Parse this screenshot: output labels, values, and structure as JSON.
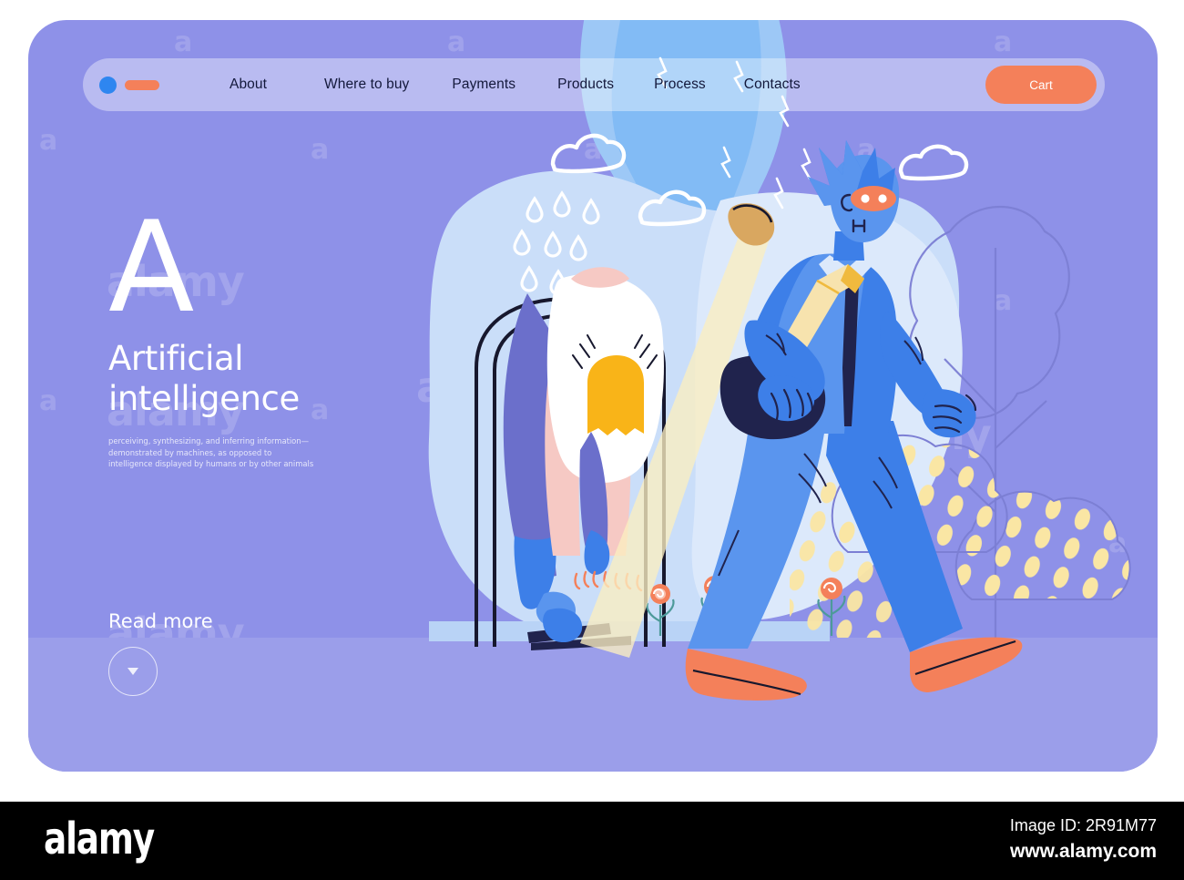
{
  "page": {
    "background_color": "#ffffff",
    "card_color": "#8e91e8"
  },
  "nav": {
    "logo": {
      "dot_color": "#2e86f0",
      "bar_color": "#f4805a"
    },
    "links": [
      {
        "label": "About"
      },
      {
        "label": "Where to buy"
      },
      {
        "label": "Payments"
      },
      {
        "label": "Products"
      },
      {
        "label": "Process"
      },
      {
        "label": "Contacts"
      }
    ],
    "cart_label": "Cart",
    "cart_color": "#f4805a"
  },
  "hero": {
    "big_letter": "A",
    "headline_line1": "Artificial",
    "headline_line2": "intelligence",
    "subcopy": "perceiving, synthesizing, and inferring information—demonstrated by machines, as opposed to intelligence displayed by humans or by other animals",
    "read_more_label": "Read more"
  },
  "illustration": {
    "title": "AI robot in business suit walking past security scanner gate",
    "palette": {
      "sky_light": "#c9dcf8",
      "sky_mid": "#b7d3f7",
      "stream_blue": "#79b3f2",
      "robot_blue": "#3d7fe8",
      "robot_blue_light": "#5a95ee",
      "robot_navy": "#20234d",
      "shoe_orange": "#f4805a",
      "strap_cream": "#f7e3ae",
      "alarm_yellow": "#f9b418",
      "skin_pink": "#f6c9c4",
      "pants_purple": "#6b6fcb",
      "bush_yellow": "#fae6a4",
      "ground_purple": "#9b9eea"
    }
  },
  "footer": {
    "logo_text": "alamy",
    "image_id": "Image ID: 2R91M77",
    "url": "www.alamy.com"
  },
  "watermark": {
    "letter": "a",
    "word": "alamy"
  }
}
